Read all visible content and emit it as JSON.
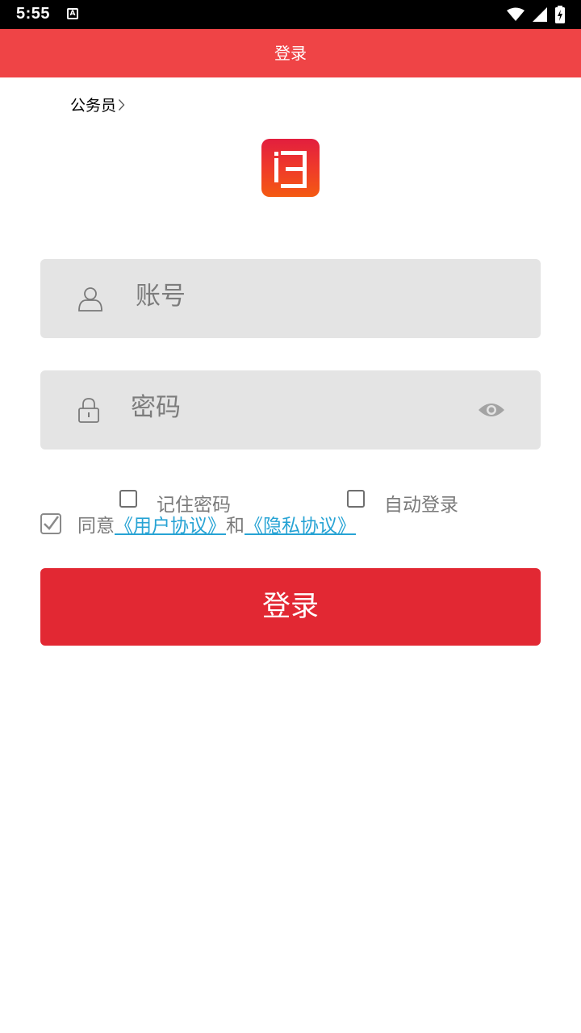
{
  "status_bar": {
    "time": "5:55",
    "notification_glyph": "A"
  },
  "header": {
    "title": "登录"
  },
  "role_selector": {
    "label": "公务员"
  },
  "account_field": {
    "placeholder": "账号"
  },
  "password_field": {
    "placeholder": "密码"
  },
  "options": {
    "remember_password": "记住密码",
    "auto_login": "自动登录"
  },
  "agreement": {
    "prefix": "同意",
    "user_agreement": "《用户协议》",
    "conjunction": "和",
    "privacy_agreement": "《隐私协议》",
    "checked": true
  },
  "login_button": {
    "label": "登录"
  },
  "colors": {
    "header": "#ef4446",
    "button": "#e22833",
    "link": "#27a3d4",
    "field_bg": "#e4e4e4"
  }
}
